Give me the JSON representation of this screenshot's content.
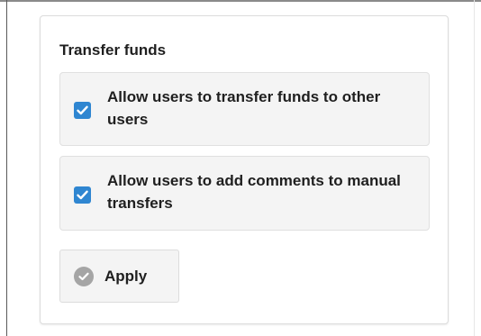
{
  "section": {
    "title": "Transfer funds"
  },
  "options": [
    {
      "label": "Allow users to transfer funds to other users",
      "checked": true
    },
    {
      "label": "Allow users to add comments to manual transfers",
      "checked": true
    }
  ],
  "actions": {
    "apply_label": "Apply",
    "apply_icon": "check-circle-icon"
  },
  "colors": {
    "checkbox_fill": "#2f86d1",
    "apply_icon": "#a5a5a5",
    "option_background": "#f4f4f4"
  }
}
